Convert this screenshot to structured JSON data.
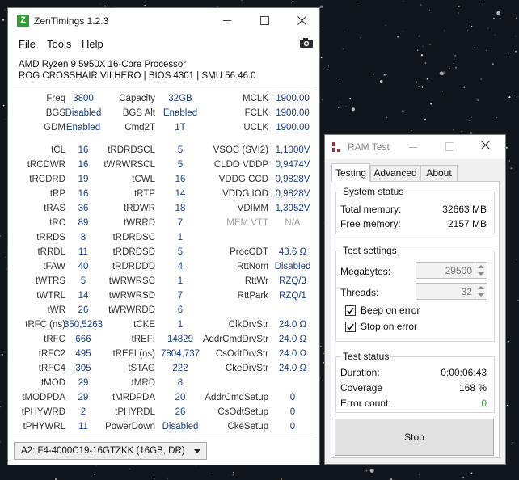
{
  "zentimings": {
    "title": "ZenTimings 1.2.3",
    "icon_letter": "Z",
    "menu": [
      "File",
      "Tools",
      "Help"
    ],
    "cpu": "AMD Ryzen 9 5950X 16-Core Processor",
    "board": "ROG CROSSHAIR VII HERO | BIOS 4301 | SMU 56.46.0",
    "top_rows": [
      [
        "Freq",
        "3800",
        "Capacity",
        "32GB",
        "MCLK",
        "1900.00"
      ],
      [
        "BGS",
        "Disabled",
        "BGS Alt",
        "Enabled",
        "FCLK",
        "1900.00"
      ],
      [
        "GDM",
        "Enabled",
        "Cmd2T",
        "1T",
        "UCLK",
        "1900.00"
      ]
    ],
    "timing_rows": [
      [
        "tCL",
        "16",
        "tRDRDSCL",
        "5",
        "VSOC (SVI2)",
        "1,1000V"
      ],
      [
        "tRCDWR",
        "16",
        "tWRWRSCL",
        "5",
        "CLDO VDDP",
        "0,9474V"
      ],
      [
        "tRCDRD",
        "19",
        "tCWL",
        "16",
        "VDDG CCD",
        "0,9828V"
      ],
      [
        "tRP",
        "16",
        "tRTP",
        "14",
        "VDDG IOD",
        "0,9828V"
      ],
      [
        "tRAS",
        "36",
        "tRDWR",
        "18",
        "VDIMM",
        "1,3952V"
      ],
      [
        "tRC",
        "89",
        "tWRRD",
        "7",
        "MEM VTT",
        "N/A"
      ],
      [
        "tRRDS",
        "8",
        "tRDRDSC",
        "1",
        "",
        ""
      ],
      [
        "tRRDL",
        "11",
        "tRDRDSD",
        "5",
        "ProcODT",
        "43.6 Ω"
      ],
      [
        "tFAW",
        "40",
        "tRDRDDD",
        "4",
        "RttNom",
        "Disabled"
      ],
      [
        "tWTRS",
        "5",
        "tWRWRSC",
        "1",
        "RttWr",
        "RZQ/3"
      ],
      [
        "tWTRL",
        "14",
        "tWRWRSD",
        "7",
        "RttPark",
        "RZQ/1"
      ],
      [
        "tWR",
        "26",
        "tWRWRDD",
        "6",
        "",
        ""
      ],
      [
        "tRFC (ns)",
        "350,5263",
        "tCKE",
        "1",
        "ClkDrvStr",
        "24.0 Ω"
      ],
      [
        "tRFC",
        "666",
        "tREFI",
        "14829",
        "AddrCmdDrvStr",
        "24.0 Ω"
      ],
      [
        "tRFC2",
        "495",
        "tREFI (ns)",
        "7804,737",
        "CsOdtDrvStr",
        "24.0 Ω"
      ],
      [
        "tRFC4",
        "305",
        "tSTAG",
        "222",
        "CkeDrvStr",
        "24.0 Ω"
      ],
      [
        "tMOD",
        "29",
        "tMRD",
        "8",
        "",
        ""
      ],
      [
        "tMODPDA",
        "29",
        "tMRDPDA",
        "20",
        "AddrCmdSetup",
        "0"
      ],
      [
        "tPHYWRD",
        "2",
        "tPHYRDL",
        "26",
        "CsOdtSetup",
        "0"
      ],
      [
        "tPHYWRL",
        "11",
        "PowerDown",
        "Disabled",
        "CkeSetup",
        "0"
      ]
    ],
    "module_select": "A2: F4-4000C19-16GTZKK (16GB, DR)",
    "dim_labels": [
      "MEM VTT"
    ]
  },
  "ramtest": {
    "title": "RAM Test",
    "tabs": [
      "Testing",
      "Advanced",
      "About"
    ],
    "active_tab": "Testing",
    "status": {
      "title": "System status",
      "total_label": "Total memory:",
      "total_value": "32663 MB",
      "free_label": "Free memory:",
      "free_value": "2157 MB"
    },
    "settings": {
      "title": "Test settings",
      "mb_label": "Megabytes:",
      "mb_value": "29500",
      "threads_label": "Threads:",
      "threads_value": "32",
      "beep_label": "Beep on error",
      "beep_checked": true,
      "stop_label": "Stop on error",
      "stop_checked": true
    },
    "test_status": {
      "title": "Test status",
      "duration_label": "Duration:",
      "duration_value": "0:00:06:43",
      "coverage_label": "Coverage",
      "coverage_value": "168 %",
      "errors_label": "Error count:",
      "errors_value": "0",
      "errors_color": "#2e9b33"
    },
    "stop_button": "Stop"
  }
}
